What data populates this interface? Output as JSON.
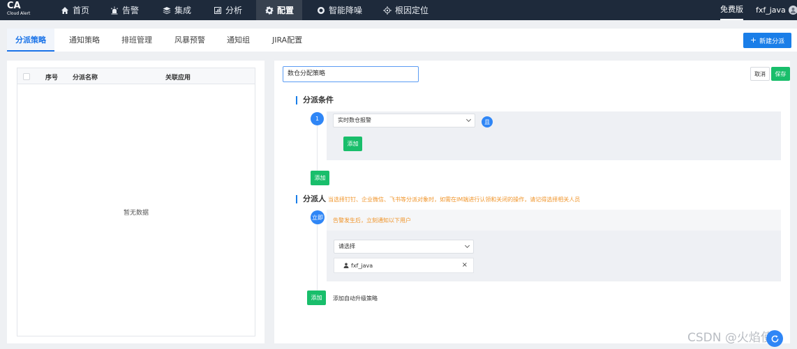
{
  "brand": {
    "name": "CA",
    "subtitle": "Cloud Alert"
  },
  "nav": [
    {
      "label": "首页",
      "icon": "home-icon"
    },
    {
      "label": "告警",
      "icon": "alarm-icon"
    },
    {
      "label": "集成",
      "icon": "layers-icon"
    },
    {
      "label": "分析",
      "icon": "chart-icon"
    },
    {
      "label": "配置",
      "icon": "gear-icon"
    },
    {
      "label": "智能降噪",
      "icon": "noise-icon"
    },
    {
      "label": "根因定位",
      "icon": "target-icon"
    }
  ],
  "edition": "免费版",
  "user": {
    "name": "fxf_java"
  },
  "tabs": [
    "分派策略",
    "通知策略",
    "排班管理",
    "风暴预警",
    "通知组",
    "JIRA配置"
  ],
  "new_button": "新建分派",
  "table": {
    "headers": [
      "序号",
      "分派名称",
      "关联应用"
    ],
    "empty_text": "暂无数据"
  },
  "editor": {
    "name_value": "数仓分配策略",
    "cancel": "取消",
    "save": "保存",
    "conditions": {
      "title": "分派条件",
      "step": "1",
      "select_value": "实时数仓报警",
      "and_label": "且",
      "inner_add": "添加",
      "outer_add": "添加"
    },
    "assignee": {
      "title": "分派人",
      "hint": "当选择钉钉、企业微信、飞书等分派对象时，如需在IM端进行认领和关闭的操作，请记得选择相关人员",
      "step": "立即",
      "description": "告警发生后，立刻通知以下用户",
      "select_placeholder": "请选择",
      "chip_user": "fxf_java",
      "add": "添加",
      "escalation": "添加自动升级策略"
    }
  },
  "watermark": "CSDN @火焰使i",
  "colors": {
    "primary": "#1a7ee8",
    "success": "#19be6b",
    "warning": "#f0952b",
    "topbar": "#1e2a3b"
  }
}
